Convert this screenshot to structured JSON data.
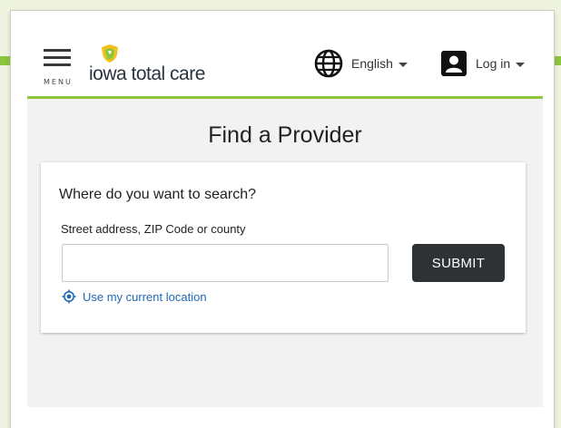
{
  "header": {
    "menu_label": "MENU",
    "logo_text": "iowa total care",
    "language": {
      "label": "English",
      "icon": "globe-icon"
    },
    "login": {
      "label": "Log in",
      "icon": "user-icon"
    }
  },
  "main": {
    "title": "Find a Provider",
    "search_card": {
      "question": "Where do you want to search?",
      "field_label": "Street address, ZIP Code or county",
      "field_value": "",
      "submit_label": "SUBMIT",
      "location_link": "Use my current location"
    }
  },
  "colors": {
    "brand_green": "#8cc63f",
    "brand_yellow": "#f2c21b",
    "button_dark": "#2f3235",
    "link_blue": "#1e68b6",
    "content_bg": "#f2f2f2"
  }
}
